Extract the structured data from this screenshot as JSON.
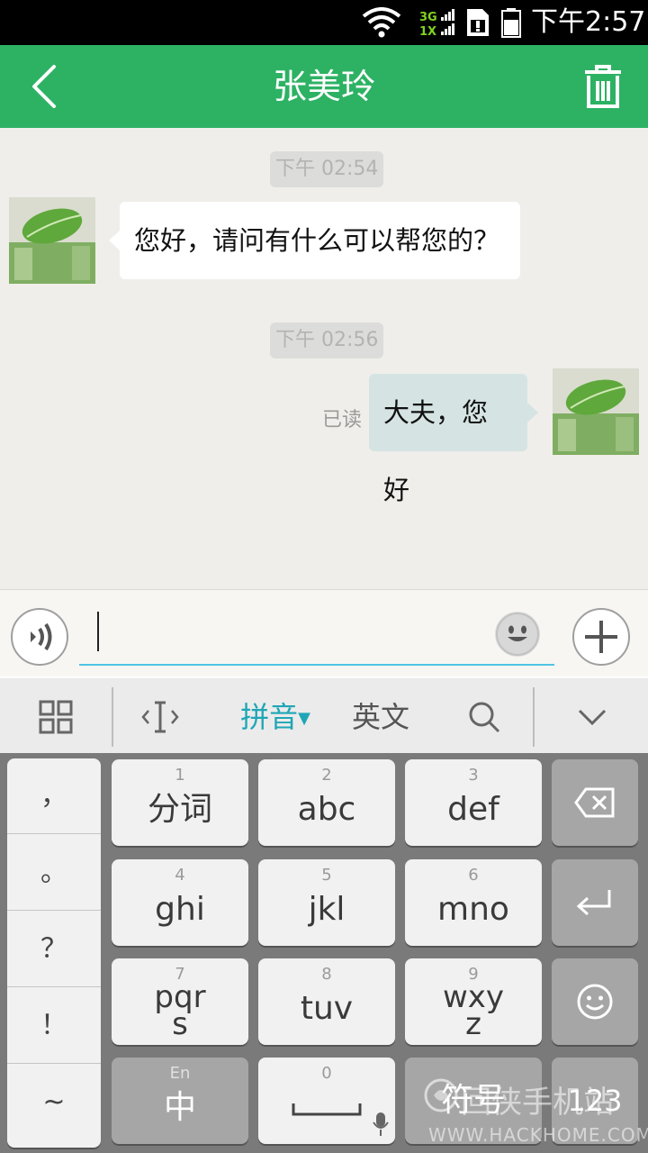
{
  "status_bar": {
    "network_top": "3G",
    "network_bottom": "1X",
    "time": "下午2:57"
  },
  "header": {
    "title": "张美玲",
    "back_icon": "chevron-left-icon",
    "delete_icon": "trash-icon"
  },
  "messages": [
    {
      "timestamp": "下午 02:54",
      "side": "left",
      "text": "您好，请问有什么可以帮您的？"
    },
    {
      "timestamp": "下午 02:56",
      "side": "right",
      "text": "大夫，您好",
      "read_status": "已读"
    }
  ],
  "input": {
    "value": "",
    "voice_icon": "voice-icon",
    "emoji_icon": "smiley-icon",
    "plus_icon": "plus-icon"
  },
  "keyboard_toolbar": {
    "items": [
      "grid-icon",
      "cursor-icon",
      "拼音",
      "英文",
      "search-icon",
      "chevron-down-icon"
    ],
    "active": "拼音",
    "pinyin": "拼音",
    "english": "英文"
  },
  "keyboard": {
    "punctuation": [
      "，",
      "。",
      "？",
      "！",
      "~"
    ],
    "keys": [
      {
        "num": "1",
        "label": "分词"
      },
      {
        "num": "2",
        "label": "abc"
      },
      {
        "num": "3",
        "label": "def"
      },
      {
        "num": "4",
        "label": "ghi"
      },
      {
        "num": "5",
        "label": "jkl"
      },
      {
        "num": "6",
        "label": "mno"
      },
      {
        "num": "7",
        "label": "pqr",
        "label2": "s"
      },
      {
        "num": "8",
        "label": "tuv"
      },
      {
        "num": "9",
        "label": "wxy",
        "label2": "z"
      }
    ],
    "zh_key": {
      "small": "En",
      "label": "中"
    },
    "space_key": {
      "num": "0"
    },
    "symbols_key": "符号",
    "num_key": "123"
  },
  "watermark": {
    "text": "回侠手机站",
    "url": "WWW.HACKHOME.COM"
  },
  "colors": {
    "brand_green": "#2db264",
    "accent_teal": "#1fa6b6",
    "bubble_right": "#d5e4e3"
  }
}
